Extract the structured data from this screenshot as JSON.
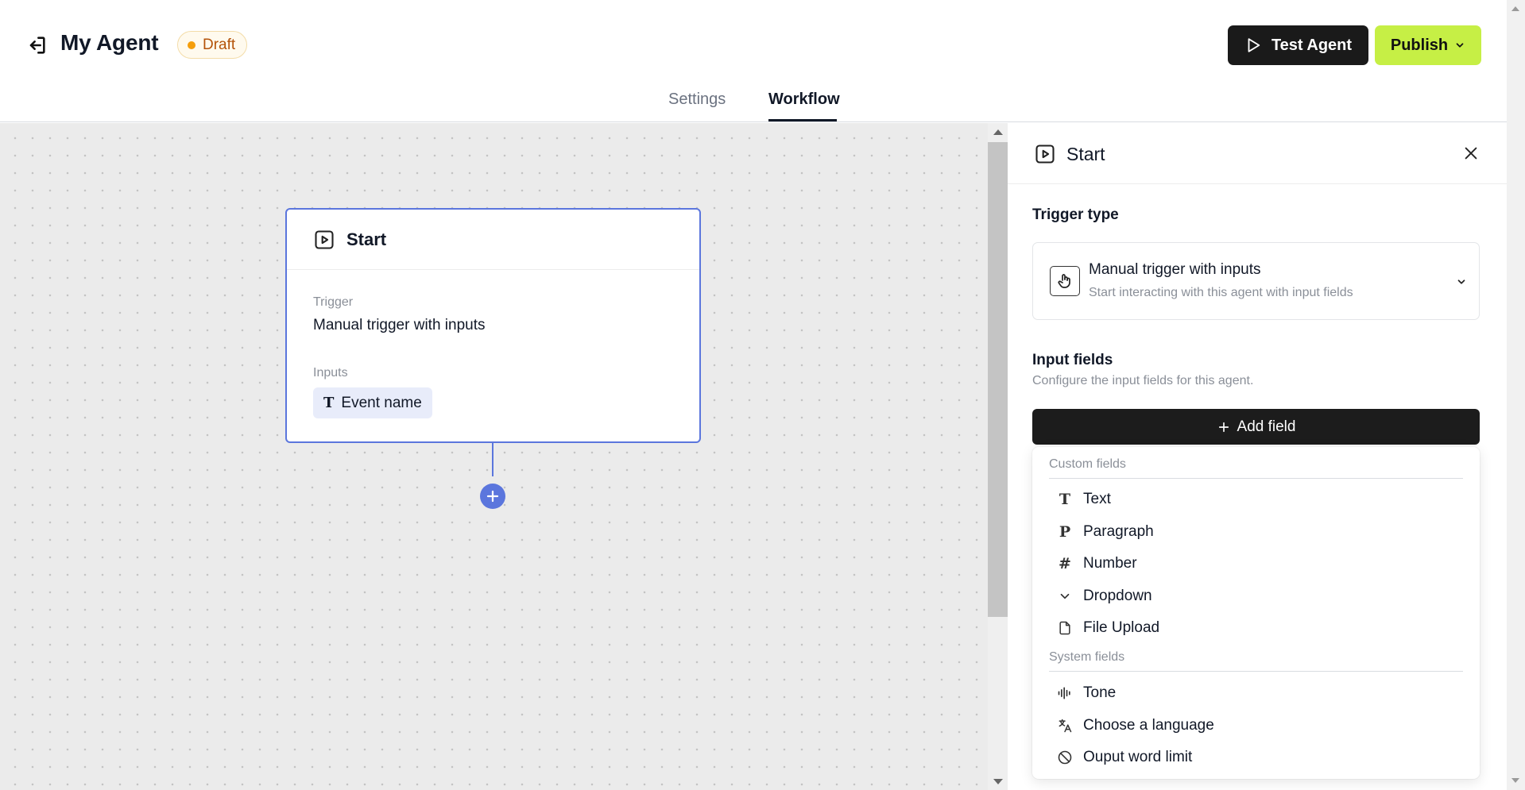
{
  "header": {
    "title": "My Agent",
    "status_badge": "Draft",
    "test_button_label": "Test Agent",
    "publish_button_label": "Publish",
    "tabs": [
      {
        "label": "Settings",
        "active": false
      },
      {
        "label": "Workflow",
        "active": true
      }
    ]
  },
  "canvas": {
    "node": {
      "title": "Start",
      "trigger_label": "Trigger",
      "trigger_value": "Manual trigger with inputs",
      "inputs_label": "Inputs",
      "input_chip": "Event name"
    }
  },
  "panel": {
    "title": "Start",
    "trigger_type_title": "Trigger type",
    "trigger": {
      "name": "Manual trigger with inputs",
      "description": "Start interacting with this agent with input fields"
    },
    "input_fields_title": "Input fields",
    "input_fields_desc": "Configure the input fields for this agent.",
    "add_field_label": "Add field",
    "dropdown": {
      "custom_label": "Custom fields",
      "custom_items": [
        {
          "label": "Text",
          "icon": "text-type-icon"
        },
        {
          "label": "Paragraph",
          "icon": "paragraph-icon"
        },
        {
          "label": "Number",
          "icon": "hash-icon"
        },
        {
          "label": "Dropdown",
          "icon": "chevron-down-icon"
        },
        {
          "label": "File Upload",
          "icon": "file-icon"
        }
      ],
      "system_label": "System fields",
      "system_items": [
        {
          "label": "Tone",
          "icon": "audio-lines-icon"
        },
        {
          "label": "Choose a language",
          "icon": "translate-icon"
        },
        {
          "label": "Ouput word limit",
          "icon": "ban-icon"
        }
      ]
    }
  },
  "colors": {
    "accent": "#5b76dd",
    "publish": "#c6ef45",
    "draft_dot": "#f59e0b",
    "draft_text": "#b45309",
    "dark_button": "#1a1a1a"
  }
}
